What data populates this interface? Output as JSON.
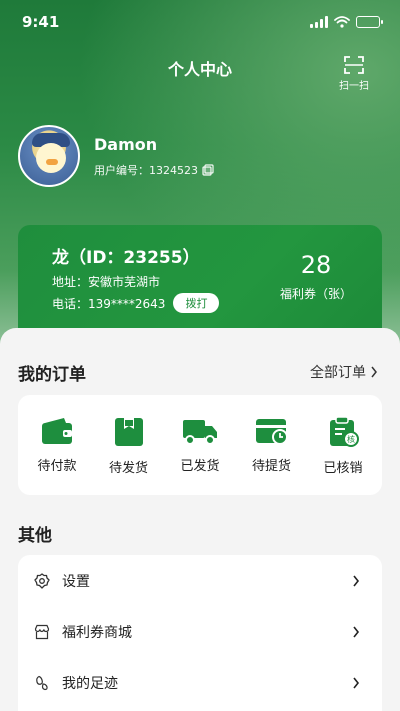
{
  "status": {
    "time": "9:41"
  },
  "nav": {
    "title": "个人中心",
    "scan_label": "扫一扫"
  },
  "profile": {
    "name": "Damon",
    "id_label": "用户编号：1324523"
  },
  "card": {
    "name": "龙（ID：23255）",
    "address": "地址：安徽市芜湖市",
    "phone": "电话：139****2643",
    "call_label": "拨打",
    "coupon_count": "28",
    "coupon_label": "福利券（张）"
  },
  "orders": {
    "title": "我的订单",
    "all_label": "全部订单",
    "items": [
      {
        "label": "待付款",
        "icon": "wallet-icon"
      },
      {
        "label": "待发货",
        "icon": "package-icon"
      },
      {
        "label": "已发货",
        "icon": "truck-icon"
      },
      {
        "label": "待提货",
        "icon": "pickup-icon"
      },
      {
        "label": "已核销",
        "icon": "verified-icon"
      }
    ]
  },
  "other": {
    "title": "其他",
    "items": [
      {
        "label": "设置",
        "icon": "gear-icon"
      },
      {
        "label": "福利券商城",
        "icon": "store-icon"
      },
      {
        "label": "我的足迹",
        "icon": "footprint-icon"
      }
    ]
  },
  "colors": {
    "brand_green": "#1f8e3d",
    "icon_green": "#1e8e3e"
  }
}
